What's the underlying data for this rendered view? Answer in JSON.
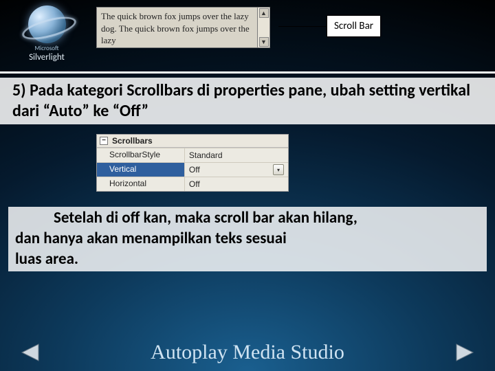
{
  "logo": {
    "brand_small": "Microsoft",
    "brand": "Silverlight"
  },
  "quickfox_text": "The quick brown fox jumps over the lazy dog. The quick brown fox jumps over the lazy",
  "callout_label": "Scroll Bar",
  "paragraph1": "5) Pada kategori Scrollbars di properties pane, ubah setting vertikal dari “Auto” ke “Off”",
  "properties": {
    "header": "Scrollbars",
    "rows": [
      {
        "key": "ScrollbarStyle",
        "value": "Standard",
        "selected": false,
        "dropdown": false
      },
      {
        "key": "Vertical",
        "value": "Off",
        "selected": true,
        "dropdown": true
      },
      {
        "key": "Horizontal",
        "value": "Off",
        "selected": false,
        "dropdown": false
      }
    ]
  },
  "paragraph2_lead": "Setelah di off kan, maka scroll bar akan hilang,",
  "paragraph2_line2": "dan hanya akan menampilkan teks sesuai",
  "paragraph2_line3": "luas area.",
  "footer_title": "Autoplay Media Studio",
  "nav": {
    "prev": "previous-slide",
    "next": "next-slide"
  }
}
